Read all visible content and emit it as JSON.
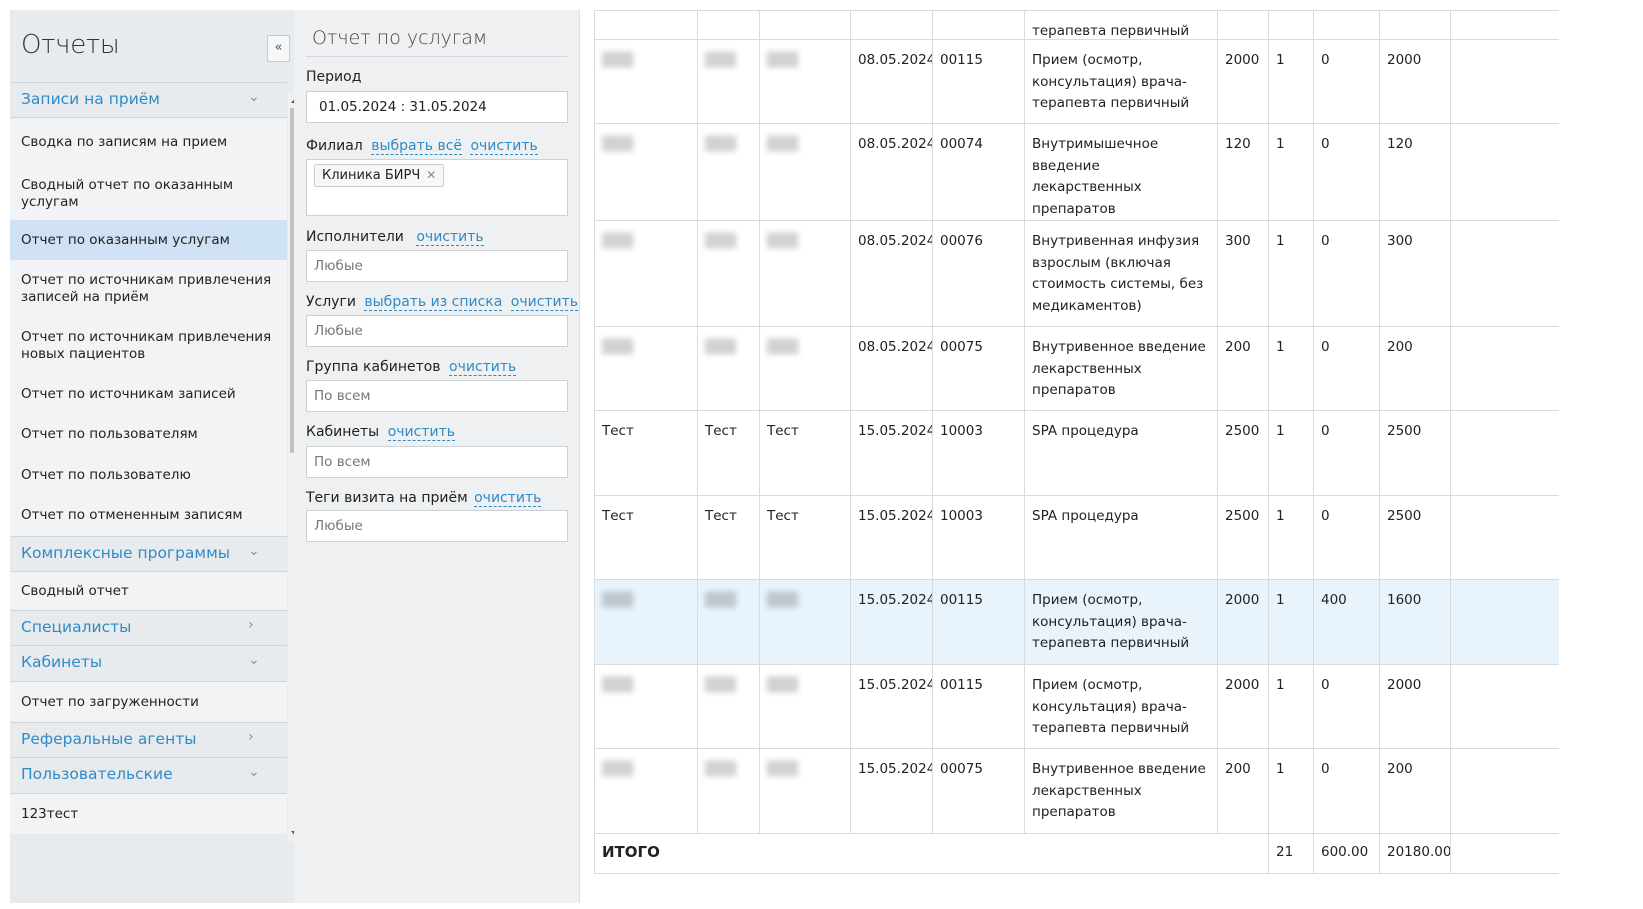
{
  "sidebar": {
    "title": "Отчеты",
    "collapse_icon": "«",
    "groups": {
      "appointments": "Записи на приём",
      "complex": "Комплексные программы",
      "specialists": "Специалисты",
      "cabinets": "Кабинеты",
      "referral": "Реферальные агенты",
      "custom": "Пользовательские"
    },
    "items": {
      "summary_appointments": "Сводка по записям на прием",
      "summary_services": "Сводный отчет по оказанным услугам",
      "services_report": "Отчет по оказанным услугам",
      "sources_appointments": "Отчет по источникам привлечения записей на приём",
      "sources_patients": "Отчет по источникам привлечения новых пациентов",
      "sources_records": "Отчет по источникам записей",
      "by_users": "Отчет по пользователям",
      "by_user": "Отчет по пользователю",
      "cancelled": "Отчет по отмененным записям",
      "summary_report": "Сводный отчет",
      "load_report": "Отчет по загруженности",
      "custom_1": "123тест"
    }
  },
  "filters": {
    "title": "Отчет по услугам",
    "period_label": "Период",
    "period_value": "01.05.2024 : 31.05.2024",
    "branch_label": "Филиал",
    "select_all": "выбрать всё",
    "clear": "очистить",
    "branch_chip": "Клиника БИРЧ",
    "executors_label": "Исполнители",
    "any": "Любые",
    "services_label": "Услуги",
    "select_from_list": "выбрать из списка",
    "cabinet_group_label": "Группа кабинетов",
    "all": "По всем",
    "cabinets_label": "Кабинеты",
    "tags_label": "Теги визита на приём"
  },
  "table": {
    "top_partial": "терапевта первичный",
    "rows": [
      {
        "c1": "",
        "c2": "",
        "c3": "",
        "date": "08.05.2024",
        "code": "00115",
        "service": "Прием (осмотр, консультация) врача-терапевта первичный",
        "price": "2000",
        "qty": "1",
        "discount": "0",
        "sum": "2000",
        "blurred": true
      },
      {
        "c1": "",
        "c2": "",
        "c3": "",
        "date": "08.05.2024",
        "code": "00074",
        "service": "Внутримышечное введение лекарственных препаратов",
        "price": "120",
        "qty": "1",
        "discount": "0",
        "sum": "120",
        "blurred": true
      },
      {
        "c1": "",
        "c2": "",
        "c3": "",
        "date": "08.05.2024",
        "code": "00076",
        "service": "Внутривенная инфузия взрослым (включая стоимость системы, без медикаментов)",
        "price": "300",
        "qty": "1",
        "discount": "0",
        "sum": "300",
        "blurred": true
      },
      {
        "c1": "",
        "c2": "",
        "c3": "",
        "date": "08.05.2024",
        "code": "00075",
        "service": "Внутривенное введение лекарственных препаратов",
        "price": "200",
        "qty": "1",
        "discount": "0",
        "sum": "200",
        "blurred": true
      },
      {
        "c1": "Тест",
        "c2": "Тест",
        "c3": "Тест",
        "date": "15.05.2024",
        "code": "10003",
        "service": "SPA процедура",
        "price": "2500",
        "qty": "1",
        "discount": "0",
        "sum": "2500",
        "blurred": false
      },
      {
        "c1": "Тест",
        "c2": "Тест",
        "c3": "Тест",
        "date": "15.05.2024",
        "code": "10003",
        "service": "SPA процедура",
        "price": "2500",
        "qty": "1",
        "discount": "0",
        "sum": "2500",
        "blurred": false
      },
      {
        "c1": "",
        "c2": "",
        "c3": "",
        "date": "15.05.2024",
        "code": "00115",
        "service": "Прием (осмотр, консультация) врача-терапевта первичный",
        "price": "2000",
        "qty": "1",
        "discount": "400",
        "sum": "1600",
        "blurred": true,
        "highlight": true
      },
      {
        "c1": "",
        "c2": "",
        "c3": "",
        "date": "15.05.2024",
        "code": "00115",
        "service": "Прием (осмотр, консультация) врача-терапевта первичный",
        "price": "2000",
        "qty": "1",
        "discount": "0",
        "sum": "2000",
        "blurred": true
      },
      {
        "c1": "",
        "c2": "",
        "c3": "",
        "date": "15.05.2024",
        "code": "00075",
        "service": "Внутривенное введение лекарственных препаратов",
        "price": "200",
        "qty": "1",
        "discount": "0",
        "sum": "200",
        "blurred": true
      }
    ],
    "total": {
      "label": "ИТОГО",
      "qty": "21",
      "discount": "600.00",
      "sum": "20180.00"
    }
  }
}
